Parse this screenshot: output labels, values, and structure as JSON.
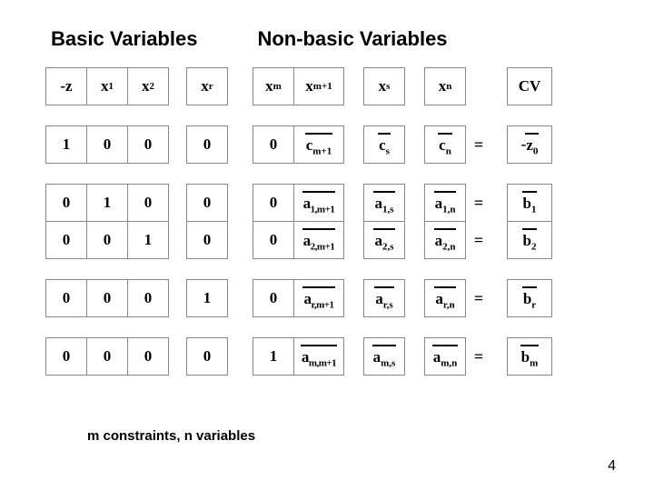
{
  "titles": {
    "left": "Basic Variables",
    "right": "Non-basic Variables"
  },
  "headers": {
    "c0": "-z",
    "c1": {
      "base": "x",
      "sub": "1"
    },
    "c2": {
      "base": "x",
      "sub": "2"
    },
    "c3": {
      "base": "x",
      "sub": "r"
    },
    "c4": {
      "base": "x",
      "sub": "m"
    },
    "c5": {
      "base": "x",
      "sub": "m+1"
    },
    "c6": {
      "base": "x",
      "sub": "s"
    },
    "c7": {
      "base": "x",
      "sub": "n"
    },
    "cv": "CV"
  },
  "row1": {
    "eq": "=",
    "c0": "1",
    "c1": "0",
    "c2": "0",
    "c3": "0",
    "c4": "0",
    "c5": {
      "bar": true,
      "base": "c",
      "sub": "m+1"
    },
    "c6": {
      "bar": true,
      "base": "c",
      "sub": "s"
    },
    "c7": {
      "bar": true,
      "base": "c",
      "sub": "n"
    },
    "cv": {
      "prefix": "-  ",
      "bar": true,
      "base": "z",
      "sub": "0"
    }
  },
  "row2": {
    "eq": "=",
    "c0": "0",
    "c1": "1",
    "c2": "0",
    "c3": "0",
    "c4": "0",
    "c5": {
      "bar": true,
      "base": "a",
      "sub": "1,m+1"
    },
    "c6": {
      "bar": true,
      "base": "a",
      "sub": "1,s"
    },
    "c7": {
      "bar": true,
      "base": "a",
      "sub": "1,n"
    },
    "cv": {
      "bar": true,
      "base": "b",
      "sub": "1"
    }
  },
  "row3": {
    "eq": "=",
    "c0": "0",
    "c1": "0",
    "c2": "1",
    "c3": "0",
    "c4": "0",
    "c5": {
      "bar": true,
      "base": "a",
      "sub": "2,m+1"
    },
    "c6": {
      "bar": true,
      "base": "a",
      "sub": "2,s"
    },
    "c7": {
      "bar": true,
      "base": "a",
      "sub": "2,n"
    },
    "cv": {
      "bar": true,
      "base": "b",
      "sub": "2"
    }
  },
  "row4": {
    "eq": "=",
    "c0": "0",
    "c1": "0",
    "c2": "0",
    "c3": "1",
    "c4": "0",
    "c5": {
      "bar": true,
      "base": "a",
      "sub": "r,m+1"
    },
    "c6": {
      "bar": true,
      "base": "a",
      "sub": "r,s"
    },
    "c7": {
      "bar": true,
      "base": "a",
      "sub": "r,n"
    },
    "cv": {
      "bar": true,
      "base": "b",
      "sub": "r"
    }
  },
  "row5": {
    "eq": "=",
    "c0": "0",
    "c1": "0",
    "c2": "0",
    "c3": "0",
    "c4": "1",
    "c5": {
      "bar": true,
      "base": "a",
      "sub": "m,m+1"
    },
    "c6": {
      "bar": true,
      "base": "a",
      "sub": "m,s"
    },
    "c7": {
      "bar": true,
      "base": "a",
      "sub": "m,n"
    },
    "cv": {
      "bar": true,
      "base": "b",
      "sub": "m"
    }
  },
  "footer": "m constraints, n variables",
  "page": "4"
}
